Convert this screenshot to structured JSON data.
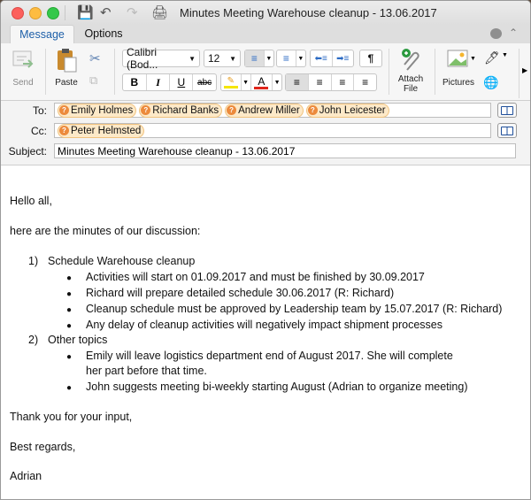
{
  "window": {
    "title": "Minutes Meeting Warehouse cleanup - 13.06.2017"
  },
  "tabs": [
    {
      "label": "Message",
      "active": true
    },
    {
      "label": "Options",
      "active": false
    }
  ],
  "ribbon": {
    "send_label": "Send",
    "paste_label": "Paste",
    "font_name": "Calibri (Bod...",
    "font_size": "12",
    "bold": "B",
    "italic": "I",
    "underline": "U",
    "strikethrough": "abc",
    "font_color_glyph": "A",
    "pilcrow": "¶",
    "attach_label_1": "Attach",
    "attach_label_2": "File",
    "pictures_label": "Pictures",
    "highlight_color": "#f5e600",
    "font_color": "#e0261b"
  },
  "headers": {
    "to_label": "To:",
    "cc_label": "Cc:",
    "subject_label": "Subject:",
    "to": [
      "Emily Holmes",
      "Richard Banks",
      "Andrew Miller",
      "John Leicester"
    ],
    "cc": [
      "Peter Helmsted"
    ],
    "subject": "Minutes Meeting Warehouse cleanup - 13.06.2017"
  },
  "body": {
    "greeting": "Hello all,",
    "intro": "here are the minutes of our discussion:",
    "items": [
      {
        "number": "1)",
        "title": "Schedule Warehouse cleanup",
        "bullets": [
          "Activities will start on 01.09.2017 and must be finished by 30.09.2017",
          "Richard will prepare detailed schedule 30.06.2017 (R: Richard)",
          "Cleanup schedule must be approved by Leadership team by 15.07.2017 (R: Richard)",
          "Any delay of cleanup activities will negatively impact shipment processes"
        ]
      },
      {
        "number": "2)",
        "title": "Other topics",
        "bullets": [
          "Emily will leave logistics department end of August 2017. She will complete",
          "her part before that time.",
          "John suggests meeting bi-weekly starting August (Adrian to organize meeting)"
        ]
      }
    ],
    "thanks": "Thank you for your input,",
    "regards": "Best regards,",
    "signature": "Adrian"
  }
}
